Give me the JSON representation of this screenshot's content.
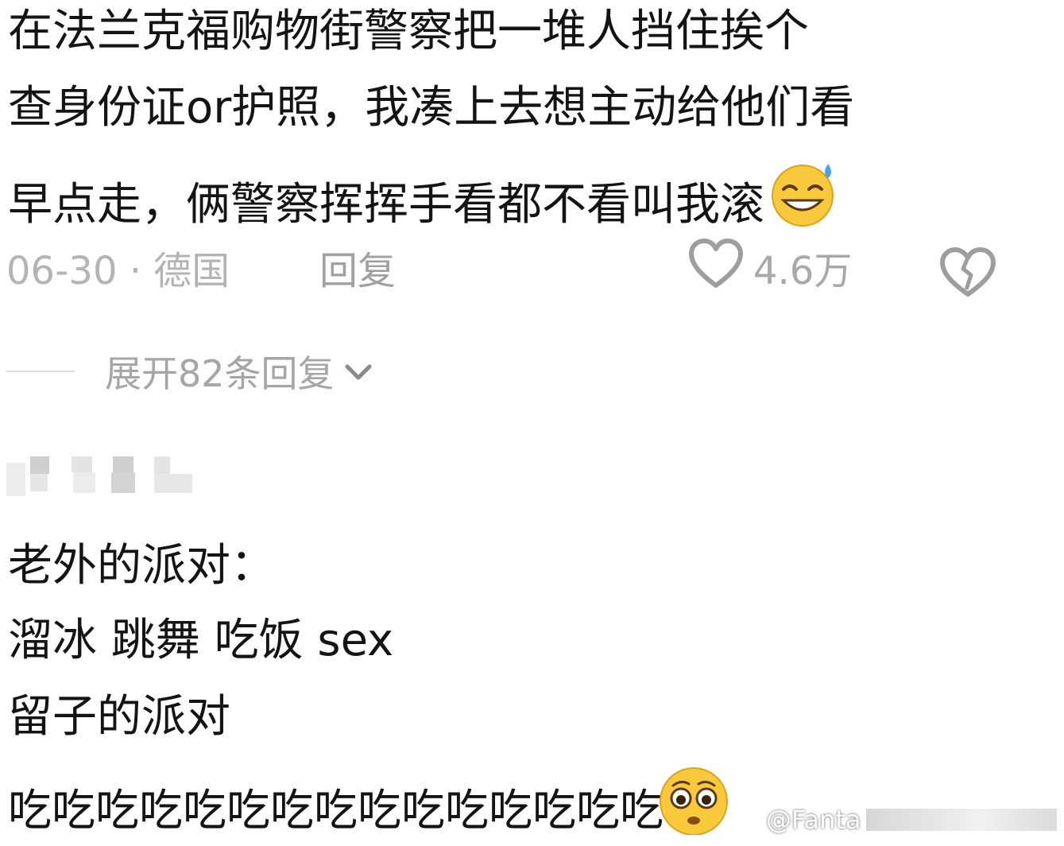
{
  "comment1": {
    "lines": [
      "在法兰克福购物街警察把一堆人挡住挨个",
      "查身份证or护照，我凑上去想主动给他们看",
      "早点走，俩警察挥挥手看都不看叫我滚"
    ],
    "emoji": "sweat-grin-emoji",
    "date_location": "06-30 · 德国",
    "reply_label": "回复",
    "like_count": "4.6万",
    "expand_label": "展开82条回复"
  },
  "comment2": {
    "lines": [
      "老外的派对：",
      "溜冰 跳舞 吃饭 sex",
      "留子的派对",
      "吃吃吃吃吃吃吃吃吃吃吃吃吃吃吃"
    ],
    "emoji": "wide-eyed-emoji"
  },
  "watermark": {
    "text": "@Fanta"
  },
  "colors": {
    "text": "#141414",
    "meta": "#b4b4b4",
    "emoji_face": "#f8c93a"
  }
}
